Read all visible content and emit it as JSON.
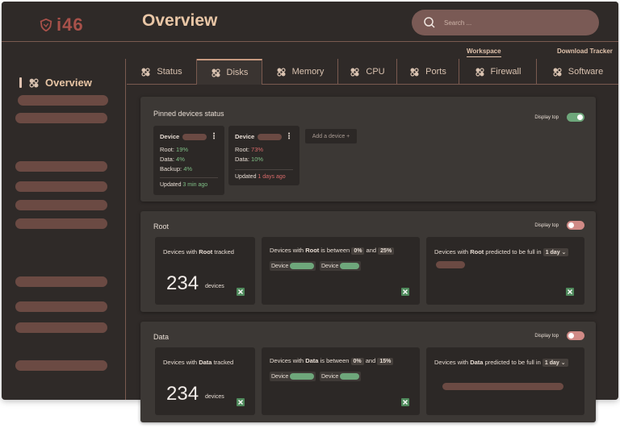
{
  "app": {
    "logo_text": "i46",
    "page_title": "Overview"
  },
  "search": {
    "placeholder": "Search ..."
  },
  "subnav": {
    "workspace": "Workspace",
    "download": "Download Tracker"
  },
  "sidebar": {
    "heading": "Overview"
  },
  "tabs": [
    "Status",
    "Disks",
    "Memory",
    "CPU",
    "Ports",
    "Firewall",
    "Software"
  ],
  "active_tab": "Disks",
  "pinned": {
    "title": "Pinned devices status",
    "display_top_label": "Display top",
    "display_top_on": true,
    "add_button": "Add a device +",
    "devices": [
      {
        "label": "Device",
        "root_label": "Root:",
        "root": "19%",
        "data_label": "Data:",
        "data": "4%",
        "backup_label": "Backup:",
        "backup": "4%",
        "updated_label": "Updated",
        "updated": "3 min ago"
      },
      {
        "label": "Device",
        "root_label": "Root:",
        "root": "73%",
        "data_label": "Data:",
        "data": "10%",
        "updated_label": "Updated",
        "updated": "1 days ago"
      }
    ]
  },
  "root": {
    "title": "Root",
    "display_top_label": "Display top",
    "display_top_on": false,
    "tracked": {
      "pre": "Devices with",
      "bold": "Root",
      "post": "tracked",
      "count": "234",
      "unit": "devices"
    },
    "between": {
      "pre": "Devices with",
      "bold": "Root",
      "mid": "is between",
      "low": "0%",
      "and": "and",
      "high": "25%",
      "devices": [
        "Device",
        "Device"
      ]
    },
    "predicted": {
      "pre": "Devices with",
      "bold": "Root",
      "post": "predicted to be full in",
      "period": "1 day"
    }
  },
  "data": {
    "title": "Data",
    "display_top_label": "Display top",
    "display_top_on": false,
    "tracked": {
      "pre": "Devices with",
      "bold": "Data",
      "post": "tracked",
      "count": "234",
      "unit": "devices"
    },
    "between": {
      "pre": "Devices with",
      "bold": "Data",
      "mid": "is between",
      "low": "0%",
      "and": "and",
      "high": "15%",
      "devices": [
        "Device",
        "Device"
      ]
    },
    "predicted": {
      "pre": "Devices with",
      "bold": "Data",
      "post": "predicted to be full in",
      "period": "1 day"
    }
  },
  "colors": {
    "accent": "#a8514a",
    "green": "#6ea77b",
    "red": "#d86a6a",
    "pill": "#6b4a43"
  },
  "icons": {
    "logo": "shield-icon",
    "search": "search-icon",
    "tab": "gear-icon",
    "export": "excel-icon"
  }
}
